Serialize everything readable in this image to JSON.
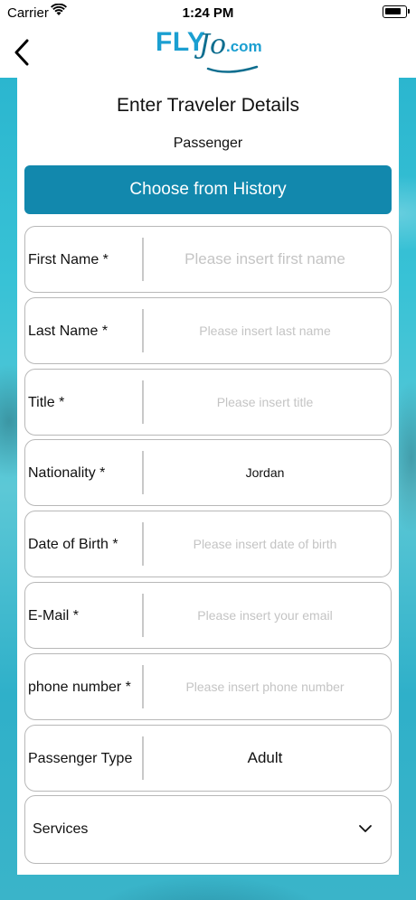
{
  "status_bar": {
    "carrier": "Carrier",
    "time": "1:24 PM"
  },
  "nav": {
    "logo_fly": "FLY",
    "logo_jo": "Jo",
    "logo_com": ".com",
    "back_icon": "chevron-left-icon"
  },
  "page": {
    "title": "Enter Traveler Details",
    "section": "Passenger",
    "history_button": "Choose from History"
  },
  "form": {
    "first_name": {
      "label": "First Name *",
      "placeholder": "Please insert first name",
      "value": ""
    },
    "last_name": {
      "label": "Last Name *",
      "placeholder": "Please insert last name",
      "value": ""
    },
    "title": {
      "label": "Title *",
      "placeholder": "Please insert title",
      "value": ""
    },
    "nationality": {
      "label": "Nationality *",
      "placeholder": "",
      "value": "Jordan"
    },
    "dob": {
      "label": "Date of Birth *",
      "placeholder": "Please insert date of birth",
      "value": ""
    },
    "email": {
      "label": "E-Mail *",
      "placeholder": "Please insert your email",
      "value": ""
    },
    "phone": {
      "label": "phone number *",
      "placeholder": "Please insert phone number",
      "value": ""
    },
    "passenger_type": {
      "label": "Passenger Type",
      "placeholder": "",
      "value": "Adult"
    },
    "services": {
      "label": "Services"
    }
  },
  "colors": {
    "accent": "#1288ad",
    "logo_blue": "#1b9fd1",
    "background_teal": "#2bb6cf"
  }
}
